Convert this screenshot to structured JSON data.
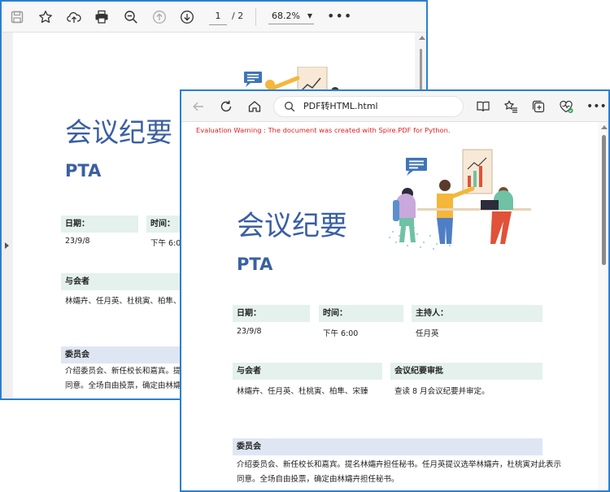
{
  "pdf_viewer": {
    "page_current": "1",
    "page_total": "/ 2",
    "zoom": "68.2%",
    "zoom_caret": "▼",
    "more": "•••",
    "document": {
      "title": "会议纪要",
      "subtitle": "PTA",
      "fields": [
        {
          "label": "日期：",
          "value": "23/9/8"
        },
        {
          "label": "时间：",
          "value": "下午 6:00"
        }
      ],
      "attendees_label": "与会者",
      "attendees_value": "林孀卉、任月英、杜桃寅、柏隼、宋臻",
      "committee_label": "委员会",
      "committee_line1": "介绍委员会、新任校长和嘉宾。提名林",
      "committee_line2": "同意。全场自由投票，确定由林孀卉担"
    }
  },
  "browser": {
    "address": "PDF转HTML.html",
    "warning": "Evaluation Warning : The document was created with Spire.PDF for Python.",
    "document": {
      "title": "会议纪要",
      "subtitle": "PTA",
      "fields": [
        {
          "label": "日期：",
          "value": "23/9/8"
        },
        {
          "label": "时间：",
          "value": "下午 6:00"
        },
        {
          "label": "主持人：",
          "value": "任月英"
        }
      ],
      "attendees_label": "与会者",
      "attendees_value": "林孀卉、任月英、杜桃寅、柏隼、宋臻",
      "review_label": "会议纪要审批",
      "review_value": "查读 8 月会议纪要并审定。",
      "committee_label": "委员会",
      "committee_line1": "介绍委员会、新任校长和嘉宾。提名林孀卉担任秘书。任月英提议选举林孀卉，杜桃寅对此表示",
      "committee_line2": "同意。全场自由投票，确定由林孀卉担任秘书。"
    }
  },
  "colors": {
    "accent_blue": "#3a5fa4",
    "label_green": "#e4f1ec",
    "label_blue": "#dfe6f3",
    "warning_red": "#e02020",
    "window_border": "#2b7fd0"
  }
}
